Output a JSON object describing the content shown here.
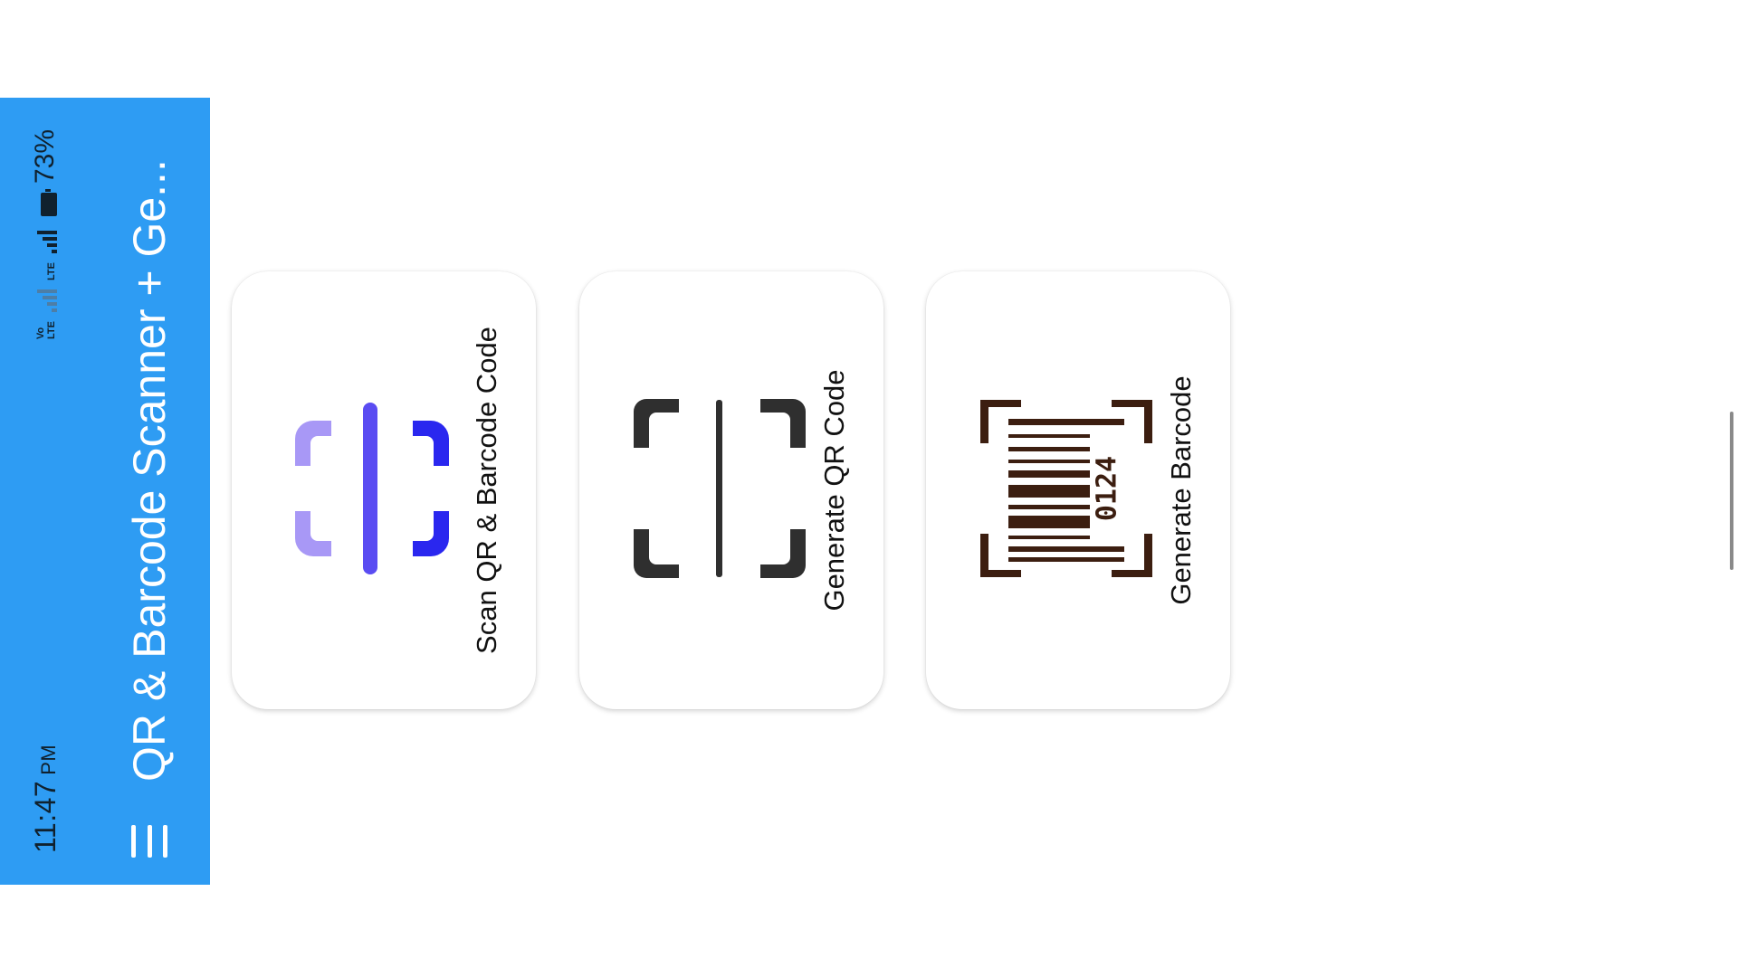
{
  "status_bar": {
    "time": "11:47",
    "ampm": "PM",
    "network_volte_top": "Vo",
    "network_volte_bottom": "LTE",
    "network_lte": "LTE",
    "battery": "73%"
  },
  "app_bar": {
    "title": "QR & Barcode Scanner + Ge...",
    "menu_icon": "hamburger-menu-icon",
    "color": "#2e9cf3"
  },
  "cards": [
    {
      "label": "Scan QR & Barcode Code",
      "icon": "scan-frame-icon",
      "icon_colors": [
        "#9c8cf5",
        "#5a4cf2",
        "#2f2cf0"
      ]
    },
    {
      "label": "Generate QR Code",
      "icon": "qr-frame-icon",
      "icon_colors": [
        "#2f2f2f"
      ]
    },
    {
      "label": "Generate Barcode",
      "icon": "barcode-icon",
      "icon_colors": [
        "#3c1e10"
      ]
    }
  ],
  "barcode_digits": "0124"
}
